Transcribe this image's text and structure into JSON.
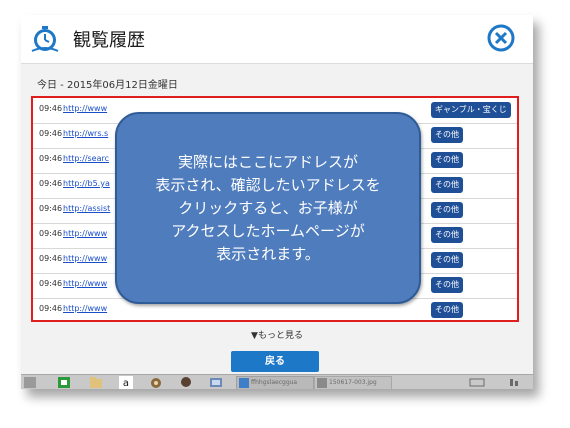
{
  "header": {
    "title": "観覧履歴",
    "icon": "history-clock-icon",
    "close_icon": "close-circle-icon",
    "accent": "#1e78c8"
  },
  "date_label": "今日 - 2015年06月12日金曜日",
  "history": [
    {
      "time": "09:46",
      "url": "http://www",
      "category": "ギャンブル・宝くじ"
    },
    {
      "time": "09:46",
      "url": "http://wrs.s",
      "category": "その他"
    },
    {
      "time": "09:46",
      "url": "http://searc",
      "category": "その他"
    },
    {
      "time": "09:46",
      "url": "http://b5.ya",
      "category": "その他"
    },
    {
      "time": "09:46",
      "url": "http://assist",
      "category": "その他"
    },
    {
      "time": "09:46",
      "url": "http://www",
      "category": "その他"
    },
    {
      "time": "09:46",
      "url": "http://www",
      "category": "その他"
    },
    {
      "time": "09:46",
      "url": "http://www",
      "category": "その他"
    },
    {
      "time": "09:46",
      "url": "http://www",
      "category": "その他"
    }
  ],
  "more_label": "▼もっと見る",
  "back_label": "戻る",
  "callout": "実際にはここにアドレスが\n表示され、確認したいアドレスを\nクリックすると、お子様が\nアクセスしたホームページが\n表示されます。",
  "taskbar": {
    "items": [
      "start-orb-icon",
      "folder-icon",
      "amazon-icon",
      "media-icon",
      "avatar-icon",
      "photo-icon",
      "app-window",
      "app-window"
    ],
    "labels": [
      "ffhhgslaecggua",
      "150617-003.jpg"
    ]
  }
}
